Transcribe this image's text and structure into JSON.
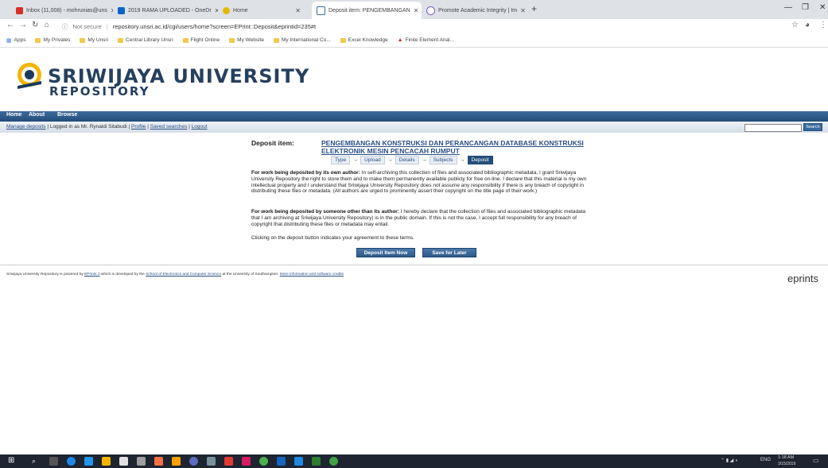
{
  "browser": {
    "tabs": [
      {
        "title": "Inbox (11,008) - mohrunias@uns",
        "active": false
      },
      {
        "title": "2019 RAMA UPLOADED - OneDr",
        "active": false
      },
      {
        "title": "Home",
        "active": false
      },
      {
        "title": "Deposit item: PENGEMBANGAN",
        "active": true
      },
      {
        "title": "Promote Academic Integrity | Im",
        "active": false
      }
    ],
    "new_tab": "+",
    "not_secure": "Not secure",
    "url": "repository.unsri.ac.id/cgi/users/home?screen=EPrint::Deposit&eprintid=235#t",
    "bookmarks": [
      "Apps",
      "My Privates",
      "My Unsri",
      "Central Library Unsri",
      "Flight Online",
      "My Website",
      "My International Co...",
      "Excel Knowledge",
      "Finite Element Anal..."
    ]
  },
  "site": {
    "title": "SRIWIJAYA UNIVERSITY",
    "subtitle": "REPOSITORY",
    "menu": [
      "Home",
      "About",
      "Browse"
    ],
    "user_links": {
      "manage": "Manage deposits",
      "logged_in": "Logged in as Mr. Rynaldi Sitabudi",
      "profile": "Profile",
      "saved": "Saved searches",
      "logout": "Logout"
    },
    "search_button": "Search"
  },
  "deposit": {
    "prefix": "Deposit item:",
    "title": "PENGEMBANGAN KONSTRUKSI DAN PERANCANGAN DATABASE KONSTRUKSI ELEKTRONIK MESIN PENCACAH RUMPUT",
    "steps": [
      "Type",
      "Upload",
      "Details",
      "Subjects",
      "Deposit"
    ],
    "current_step": "Deposit",
    "para1_bold": "For work being deposited by its own author:",
    "para1": " In self-archiving this collection of files and associated bibliographic metadata, I grant Sriwijaya University Repository the right to store them and to make them permanently available publicly for free on-line. I declare that this material is my own intellectual property and I understand that Sriwijaya University Repository does not assume any responsibility if there is any breach of copyright in distributing these files or metadata. (All authors are urged to prominently assert their copyright on the title page of their work.)",
    "para2_bold": "For work being deposited by someone other than its author:",
    "para2": " I hereby declare that the collection of files and associated bibliographic metadata that I am archiving at Sriwijaya University Repository) is in the public domain. If this is not the case, I accept full responsibility for any breach of copyright that distributing these files or metadata may entail.",
    "para3": "Clicking on the deposit button indicates your agreement to these terms.",
    "deposit_button": "Deposit Item Now",
    "save_button": "Save for Later"
  },
  "footer": {
    "pre": "Sriwijaya University Repository is powered by ",
    "eprints_link": "EPrints 3",
    "mid": " which is developed by the ",
    "school_link": "School of Electronics and Computer Science",
    "post": " at the University of Southampton. ",
    "more_link": "More information and software credits",
    "logo": "eprints"
  },
  "taskbar": {
    "lang": "ENG",
    "time": "1:18 AM",
    "date": "3/15/2019"
  },
  "colors": {
    "brand": "#25405f",
    "menubar": "#234d79",
    "link": "#2a4f85",
    "taskbar": "#1e2430"
  }
}
